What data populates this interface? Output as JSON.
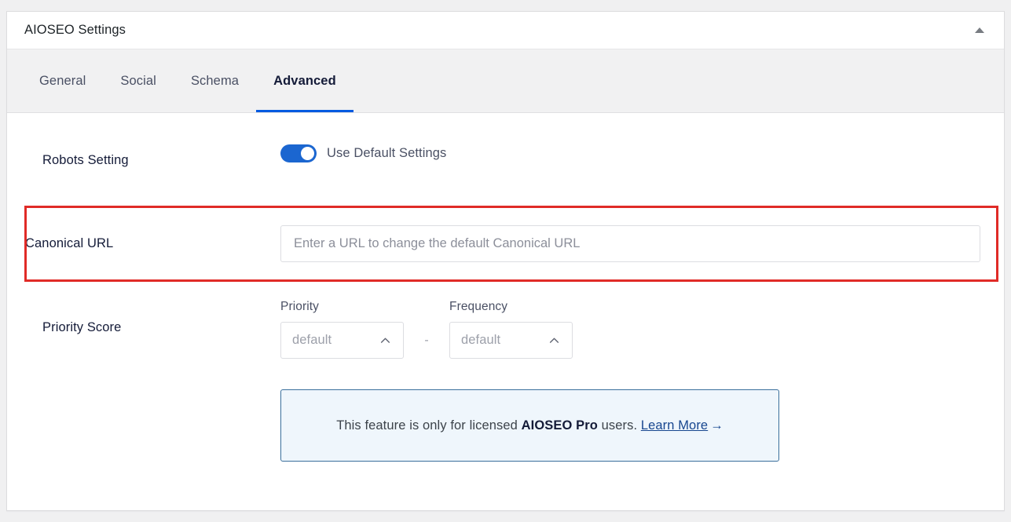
{
  "page": {
    "background": "#f0f0f1"
  },
  "card": {
    "title": "AIOSEO Settings",
    "collapse_icon": "caret-up-icon"
  },
  "tabs": [
    {
      "label": "General",
      "active": false
    },
    {
      "label": "Social",
      "active": false
    },
    {
      "label": "Schema",
      "active": false
    },
    {
      "label": "Advanced",
      "active": true
    }
  ],
  "rows": {
    "robots": {
      "label": "Robots Setting",
      "toggle": {
        "state": "on",
        "label": "Use Default Settings",
        "color": "#1b66d0"
      }
    },
    "canonical": {
      "label": "Canonical URL",
      "input": {
        "value": "",
        "placeholder": "Enter a URL to change the default Canonical URL"
      },
      "highlight_color": "#e02b27"
    },
    "priority": {
      "label": "Priority Score",
      "priority": {
        "label": "Priority",
        "value": "default",
        "chevron": "chevron-up-icon"
      },
      "separator": "-",
      "frequency": {
        "label": "Frequency",
        "value": "default",
        "chevron": "chevron-up-icon"
      }
    }
  },
  "notice": {
    "text_before": "This feature is only for licensed ",
    "brand": "AIOSEO Pro",
    "text_after": " users. ",
    "link_label": "Learn More",
    "arrow": "→",
    "background": "#eff6fc",
    "border": "#3a6f9c",
    "link_color": "#17468f"
  },
  "accent": {
    "tab_underline": "#005ae0",
    "text_dark": "#141b38",
    "text_muted": "#4a5064"
  }
}
